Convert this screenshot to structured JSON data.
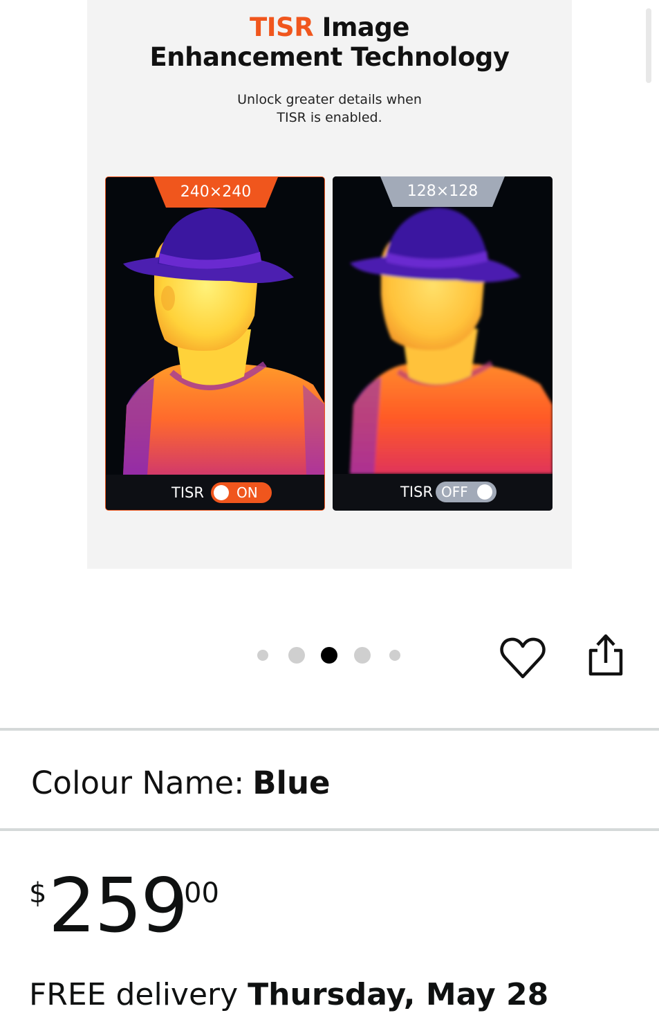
{
  "product_image": {
    "title_accent": "TISR",
    "title_line1_rest": " Image",
    "title_line2": "Enhancement Technology",
    "subtitle_line1": "Unlock greater details when",
    "subtitle_line2": "TISR is enabled.",
    "panels": [
      {
        "resolution": "240×240",
        "toggle_label": "TISR",
        "toggle_state": "ON",
        "enabled": true
      },
      {
        "resolution": "128×128",
        "toggle_label": "TISR",
        "toggle_state": "OFF",
        "enabled": false
      }
    ]
  },
  "carousel": {
    "total_dots": 5,
    "active_index": 2
  },
  "actions": {
    "wishlist_icon": "heart-icon",
    "share_icon": "share-icon"
  },
  "colour": {
    "label": "Colour Name:",
    "value": "Blue"
  },
  "price": {
    "symbol": "$",
    "whole": "259",
    "fraction": "00"
  },
  "delivery": {
    "prefix": "FREE delivery",
    "date": "Thursday, May 28"
  },
  "colors": {
    "accent": "#f0561d",
    "off_grey": "#a2aab8",
    "divider": "#d5d9d9"
  }
}
